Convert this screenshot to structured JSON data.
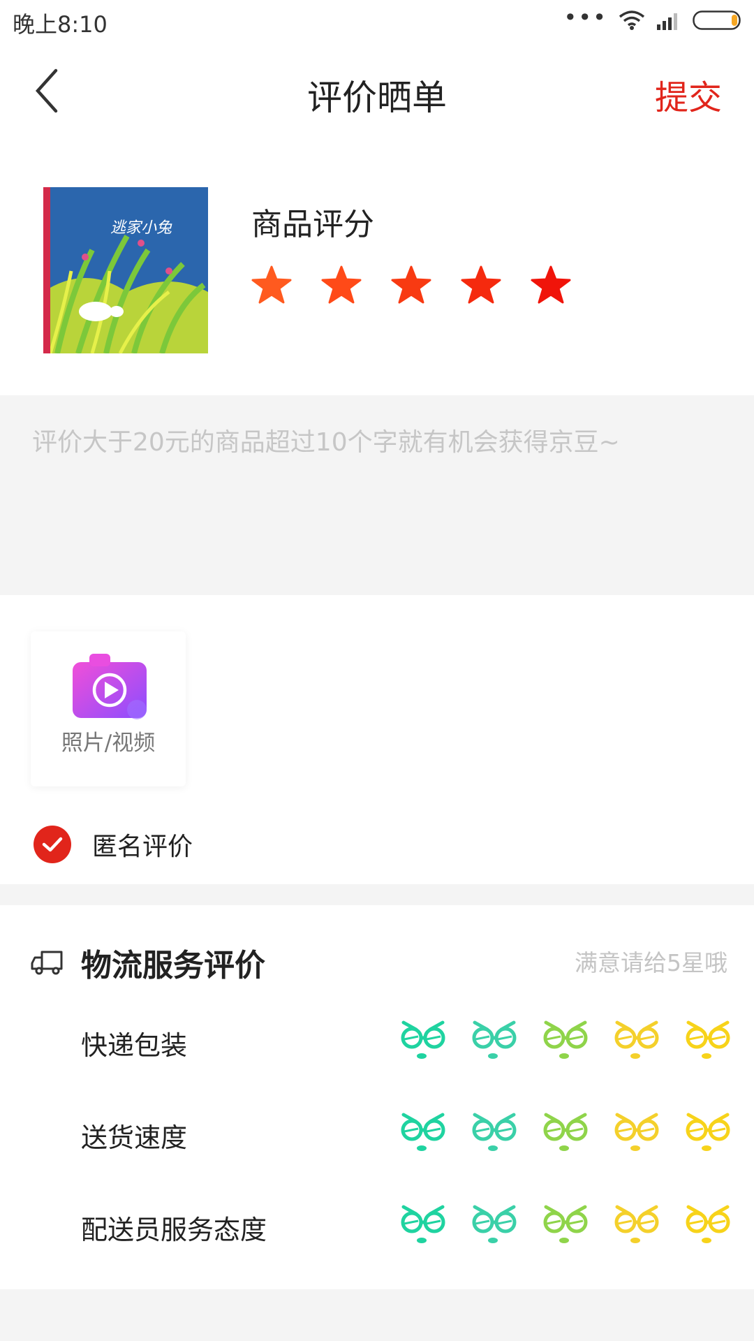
{
  "statusbar": {
    "time": "晚上8:10"
  },
  "nav": {
    "title": "评价晒单",
    "submit": "提交"
  },
  "product": {
    "book_title": "逃家小兔",
    "rating_label": "商品评分",
    "rating": 5,
    "star_colors": [
      "#ff5a1f",
      "#ff4a18",
      "#f83a12",
      "#f52a0e",
      "#f0140a"
    ]
  },
  "review": {
    "placeholder": "评价大于20元的商品超过10个字就有机会获得京豆~"
  },
  "media": {
    "upload_label": "照片/视频"
  },
  "anonymous": {
    "label": "匿名评价",
    "checked": true
  },
  "logistics": {
    "title": "物流服务评价",
    "hint": "满意请给5星哦",
    "face_colors": [
      "#1fd3a0",
      "#3ad0a8",
      "#8fd44a",
      "#f4d02b",
      "#f7d31a"
    ],
    "rows": [
      {
        "label": "快递包装"
      },
      {
        "label": "送货速度"
      },
      {
        "label": "配送员服务态度"
      }
    ]
  }
}
